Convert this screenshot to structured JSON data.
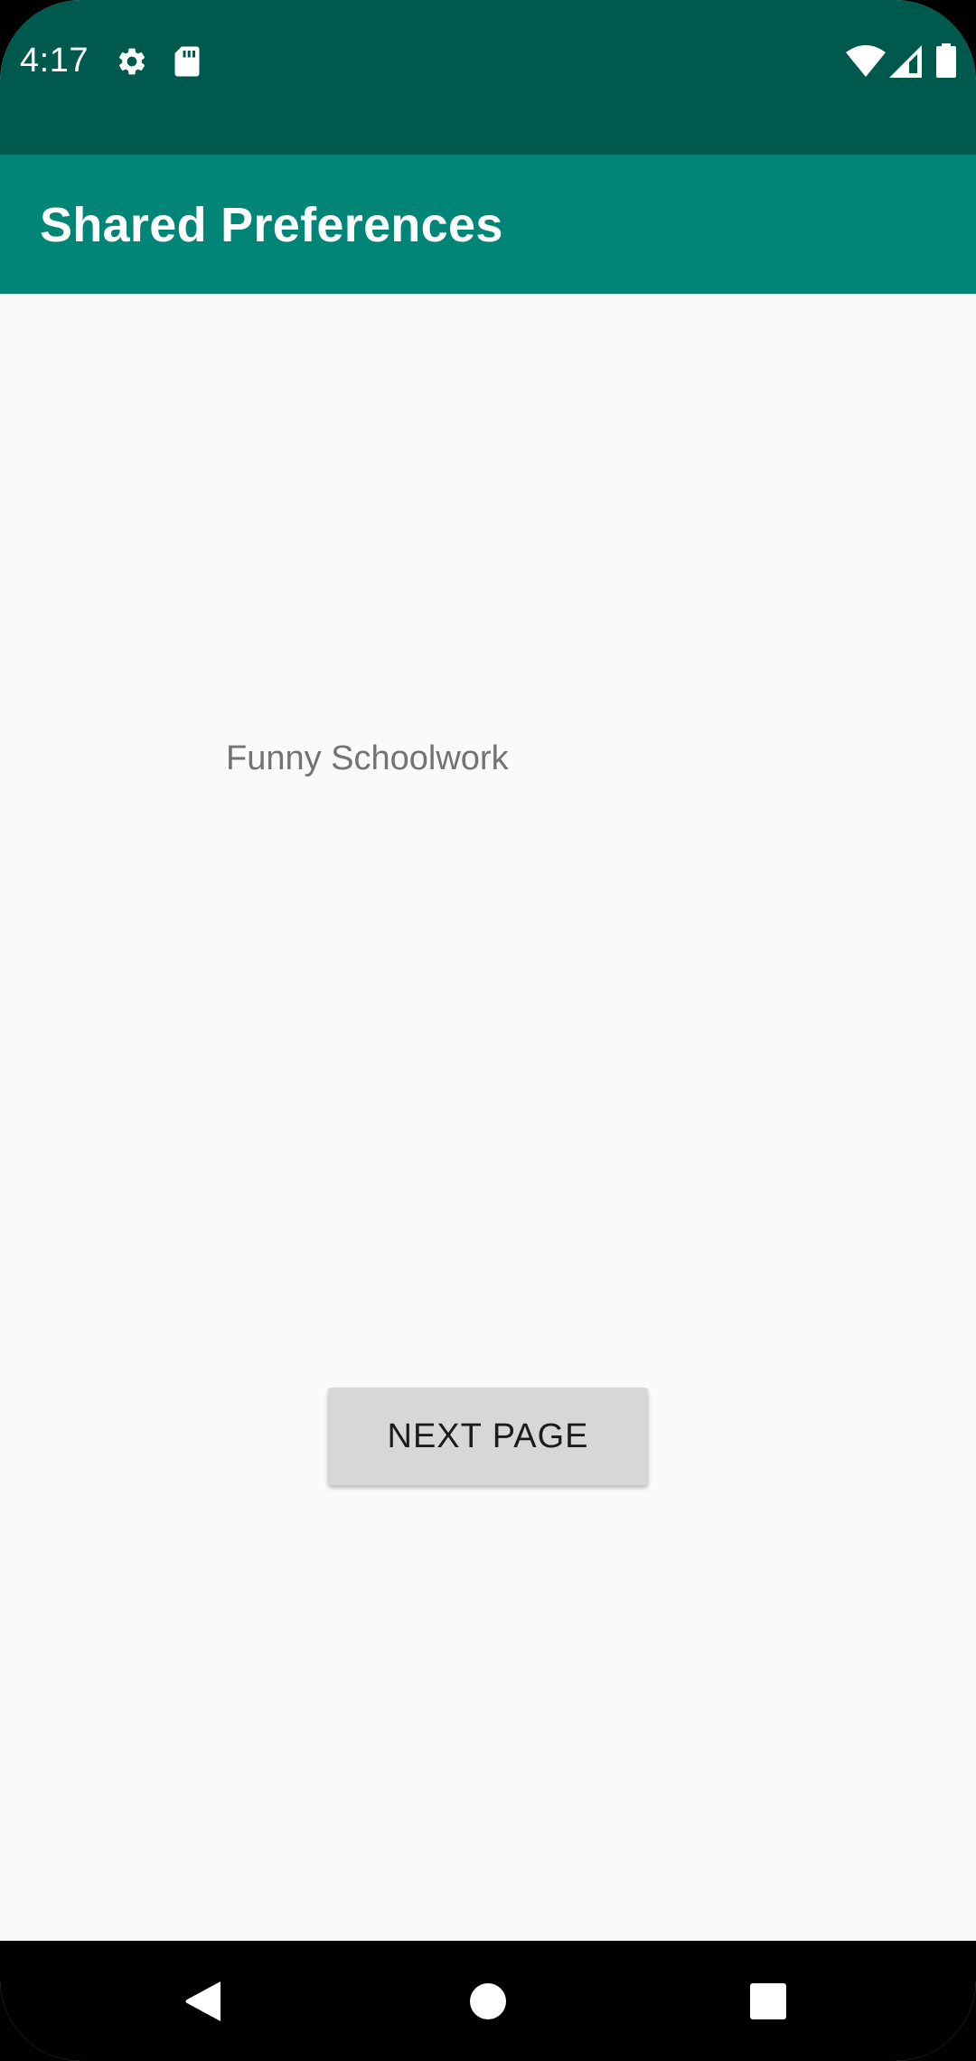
{
  "status_bar": {
    "time": "4:17",
    "left_icons": [
      "settings-gear-icon",
      "sd-card-icon"
    ],
    "right_icons": [
      "wifi-icon",
      "cell-signal-icon",
      "battery-icon"
    ],
    "background_color": "#00594d"
  },
  "app_bar": {
    "title": "Shared Preferences",
    "background_color": "#008577"
  },
  "main": {
    "label": "Funny Schoolwork",
    "next_button_label": "NEXT PAGE"
  },
  "nav_bar": {
    "buttons": [
      "back-icon",
      "home-icon",
      "recents-icon"
    ]
  }
}
